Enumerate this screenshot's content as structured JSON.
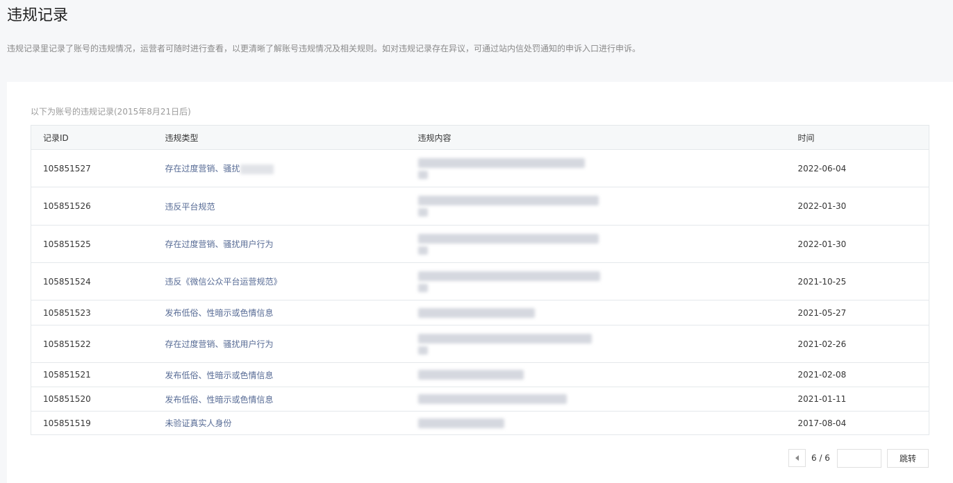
{
  "header": {
    "title": "违规记录",
    "description": "违规记录里记录了账号的违规情况，运营者可随时进行查看，以更清晰了解账号违规情况及相关规则。如对违规记录存在异议，可通过站内信处罚通知的申诉入口进行申诉。"
  },
  "records": {
    "caption": "以下为账号的违规记录(2015年8月21日后)",
    "columns": [
      "记录ID",
      "违规类型",
      "违规内容",
      "时间"
    ],
    "rows": [
      {
        "id": "105851527",
        "type": "存在过度营销、骚扰",
        "content": "",
        "time": "2022-06-04"
      },
      {
        "id": "105851526",
        "type": "违反平台规范",
        "content": "",
        "time": "2022-01-30"
      },
      {
        "id": "105851525",
        "type": "存在过度营销、骚扰用户行为",
        "content": "",
        "time": "2022-01-30"
      },
      {
        "id": "105851524",
        "type": "违反《微信公众平台运营规范》",
        "content": "",
        "time": "2021-10-25"
      },
      {
        "id": "105851523",
        "type": "发布低俗、性暗示或色情信息",
        "content": "",
        "time": "2021-05-27"
      },
      {
        "id": "105851522",
        "type": "存在过度营销、骚扰用户行为",
        "content": "",
        "time": "2021-02-26"
      },
      {
        "id": "105851521",
        "type": "发布低俗、性暗示或色情信息",
        "content": "",
        "time": "2021-02-08"
      },
      {
        "id": "105851520",
        "type": "发布低俗、性暗示或色情信息",
        "content": "",
        "time": "2021-01-11"
      },
      {
        "id": "105851519",
        "type": "未验证真实人身份",
        "content": "",
        "time": "2017-08-04"
      }
    ]
  },
  "pager": {
    "page_text": "6 / 6",
    "input_value": "",
    "jump_label": "跳转",
    "prev_icon": "chevron-left-icon"
  },
  "colors": {
    "link": "#576b95",
    "background": "#f6f7f9",
    "border": "#e4e8eb"
  }
}
